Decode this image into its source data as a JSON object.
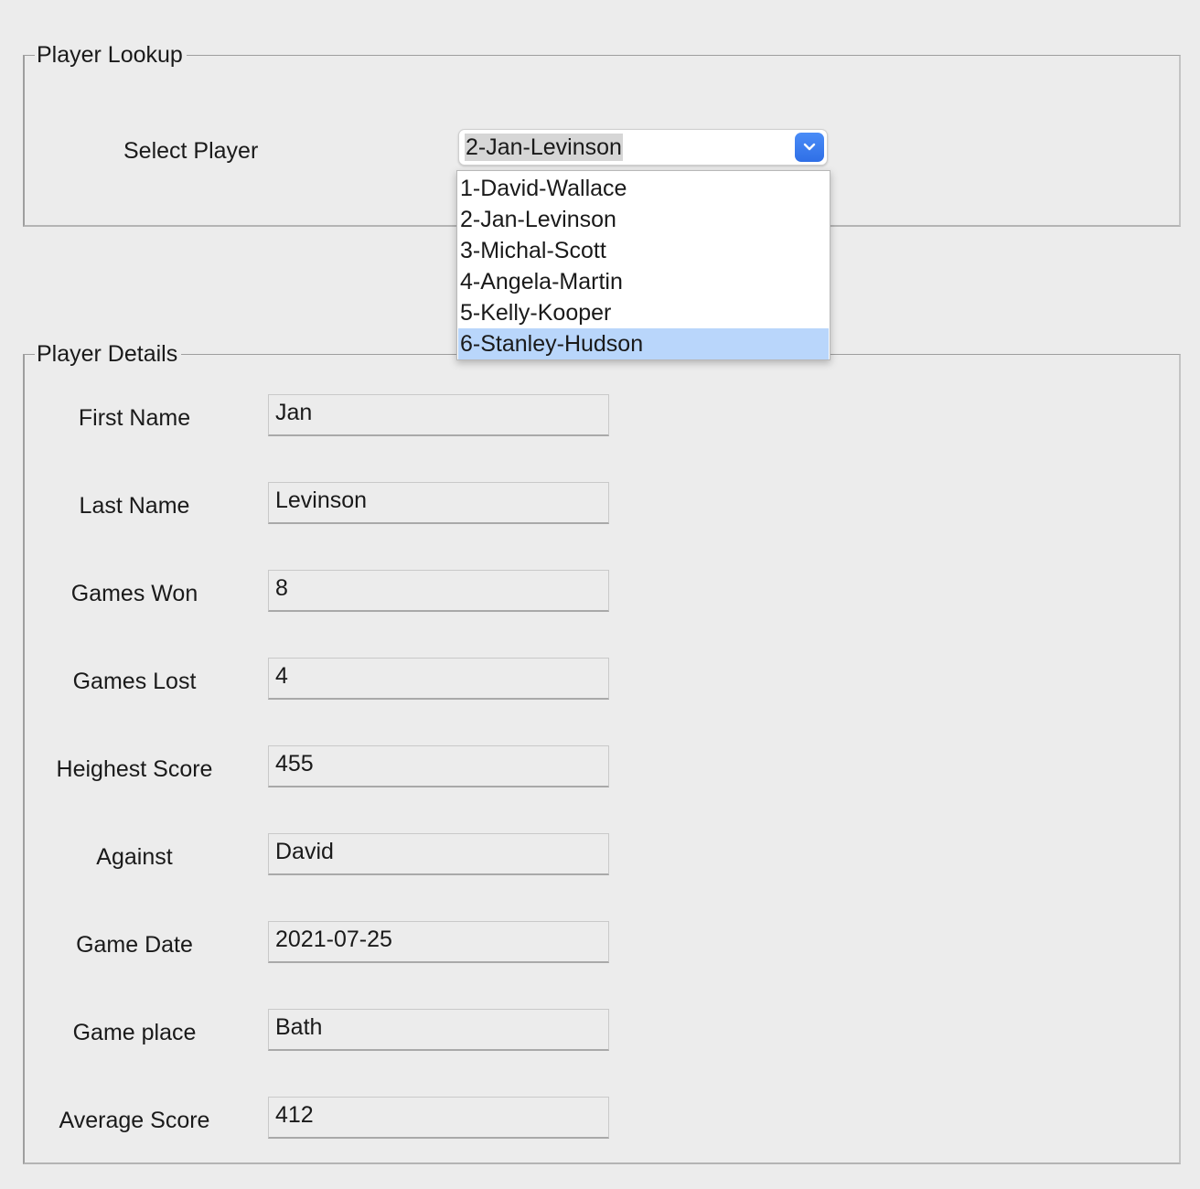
{
  "lookup": {
    "title": "Player Lookup",
    "select_label": "Select Player",
    "selected_value": "2-Jan-Levinson",
    "options": [
      "1-David-Wallace",
      "2-Jan-Levinson",
      "3-Michal-Scott",
      "4-Angela-Martin",
      "5-Kelly-Kooper",
      "6-Stanley-Hudson"
    ],
    "highlighted_option": "6-Stanley-Hudson"
  },
  "details": {
    "title": "Player Details",
    "fields": [
      {
        "label": "First Name",
        "value": "Jan"
      },
      {
        "label": "Last Name",
        "value": "Levinson"
      },
      {
        "label": "Games Won",
        "value": "8"
      },
      {
        "label": "Games Lost",
        "value": "4"
      },
      {
        "label": "Heighest Score",
        "value": "455"
      },
      {
        "label": "Against",
        "value": "David"
      },
      {
        "label": "Game Date",
        "value": "2021-07-25"
      },
      {
        "label": "Game place",
        "value": "Bath"
      },
      {
        "label": "Average Score",
        "value": "412"
      }
    ]
  },
  "colors": {
    "window_bg": "#ececec",
    "accent": "#2f6fe6",
    "selection": "#b9d6fb"
  }
}
